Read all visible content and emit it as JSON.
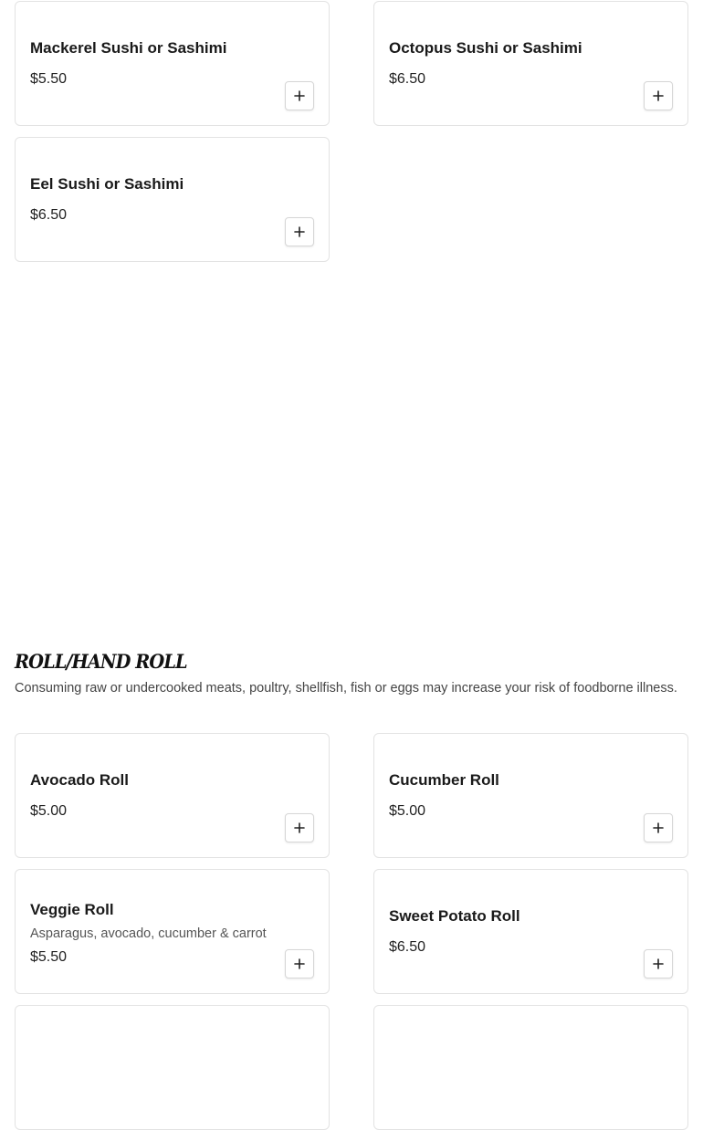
{
  "top_items": [
    {
      "name": "Mackerel Sushi or Sashimi",
      "description": "",
      "price": "$5.50",
      "add_icon": "plus-icon"
    },
    {
      "name": "Octopus Sushi or Sashimi",
      "description": "",
      "price": "$6.50",
      "add_icon": "plus-icon"
    },
    {
      "name": "Eel Sushi or Sashimi",
      "description": "",
      "price": "$6.50",
      "add_icon": "plus-icon"
    }
  ],
  "section": {
    "title": "ROLL/HAND ROLL",
    "note": "Consuming raw or undercooked meats, poultry, shellfish, fish or eggs may increase your risk of foodborne illness."
  },
  "section_items": [
    {
      "name": "Avocado Roll",
      "description": "",
      "price": "$5.00",
      "add_icon": "plus-icon"
    },
    {
      "name": "Cucumber Roll",
      "description": "",
      "price": "$5.00",
      "add_icon": "plus-icon"
    },
    {
      "name": "Veggie Roll",
      "description": "Asparagus, avocado, cucumber & carrot",
      "price": "$5.50",
      "add_icon": "plus-icon"
    },
    {
      "name": "Sweet Potato Roll",
      "description": "",
      "price": "$6.50",
      "add_icon": "plus-icon"
    }
  ],
  "colors": {
    "card_border": "#e3e3e3",
    "text": "#1a1a1a",
    "muted": "#555555"
  }
}
